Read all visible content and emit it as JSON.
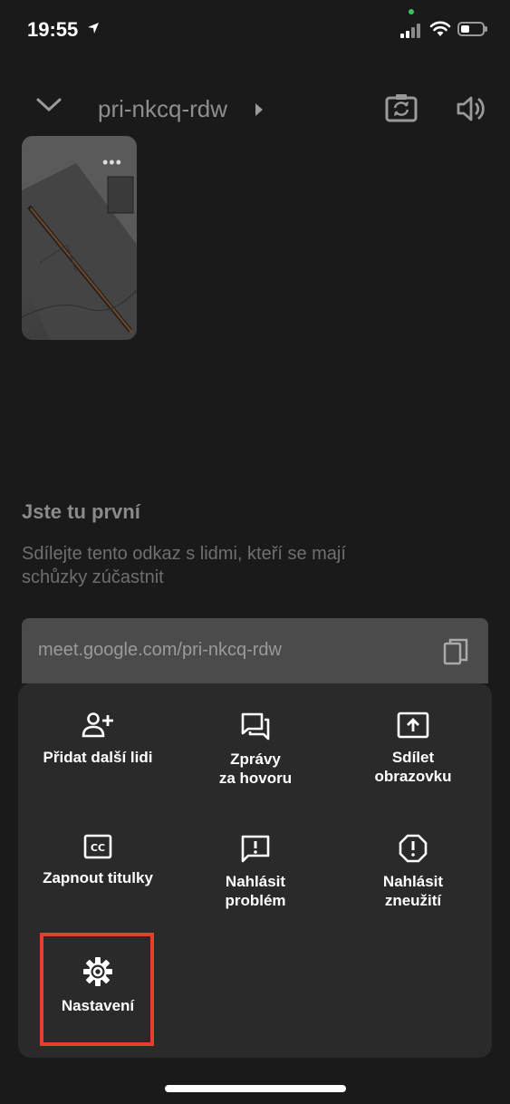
{
  "status_bar": {
    "time": "19:55"
  },
  "top_bar": {
    "meeting_name": "pri-nkcq-rdw"
  },
  "info": {
    "title": "Jste tu první",
    "description": "Sdílejte tento odkaz s lidmi, kteří se mají schůzky zúčastnit",
    "link": "meet.google.com/pri-nkcq-rdw"
  },
  "menu": {
    "add_people": "Přidat další lidi",
    "messages": "Zprávy\nza hovoru",
    "share_screen": "Sdílet\nobrazovku",
    "captions": "Zapnout titulky",
    "report_problem": "Nahlásit\nproblém",
    "report_abuse": "Nahlásit\nzneužití",
    "settings": "Nastavení"
  },
  "colors": {
    "highlight": "#e5402b",
    "sheet": "#2a2a2a",
    "background": "#1a1a1a"
  }
}
